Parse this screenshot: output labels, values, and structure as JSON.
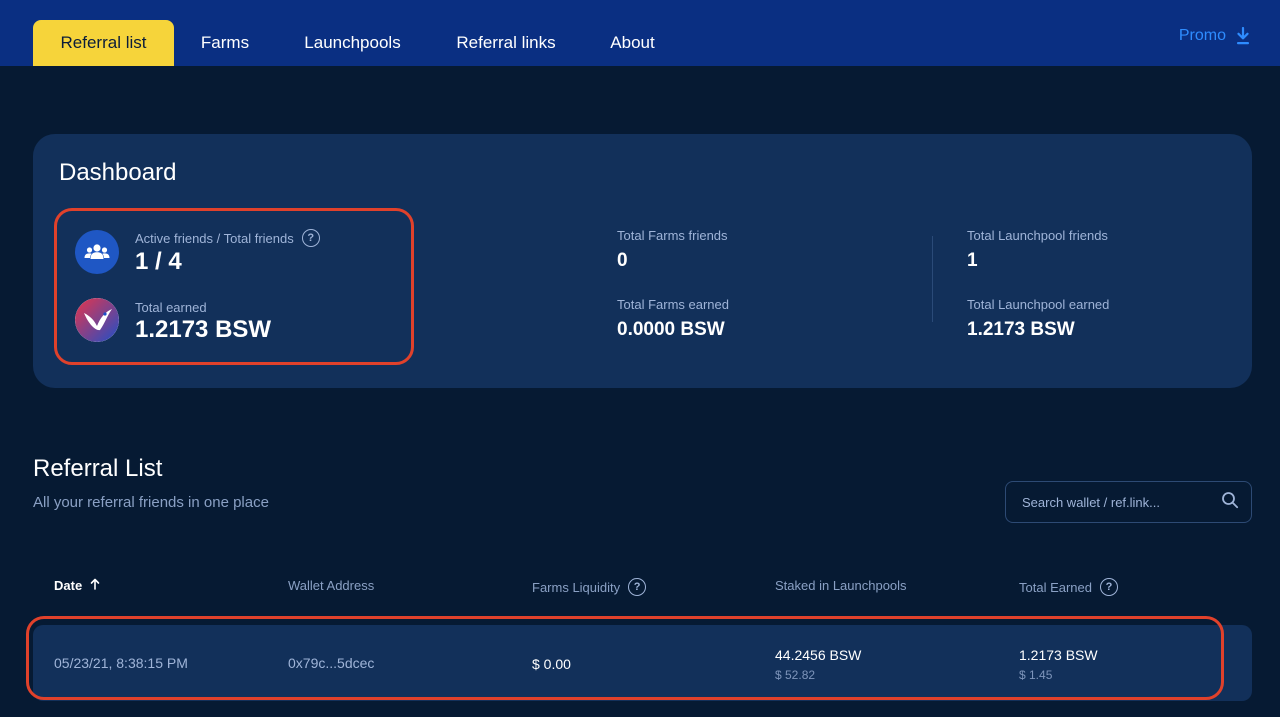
{
  "nav": {
    "tabs": [
      {
        "label": "Referral list",
        "active": true
      },
      {
        "label": "Farms"
      },
      {
        "label": "Launchpools"
      },
      {
        "label": "Referral links"
      },
      {
        "label": "About"
      }
    ],
    "promo_label": "Promo"
  },
  "dashboard": {
    "title": "Dashboard",
    "friends_label": "Active friends / Total friends",
    "friends_value": "1 / 4",
    "earned_label": "Total earned",
    "earned_value": "1.2173 BSW",
    "farms_friends_label": "Total Farms friends",
    "farms_friends_value": "0",
    "farms_earned_label": "Total Farms earned",
    "farms_earned_value": "0.0000 BSW",
    "launch_friends_label": "Total Launchpool friends",
    "launch_friends_value": "1",
    "launch_earned_label": "Total Launchpool earned",
    "launch_earned_value": "1.2173 BSW"
  },
  "referral": {
    "title": "Referral List",
    "subtitle": "All your referral friends in one place",
    "search_placeholder": "Search wallet / ref.link...",
    "columns": {
      "date": "Date",
      "wallet": "Wallet Address",
      "farms": "Farms Liquidity",
      "staked": "Staked in Launchpools",
      "earned": "Total Earned"
    },
    "rows": [
      {
        "date": "05/23/21, 8:38:15 PM",
        "wallet": "0x79c...5dcec",
        "farms": "$ 0.00",
        "staked": "44.2456 BSW",
        "staked_usd": "$ 52.82",
        "earned": "1.2173 BSW",
        "earned_usd": "$ 1.45"
      }
    ]
  },
  "colors": {
    "nav_bg": "#0a2f82",
    "active_tab": "#f6d43a",
    "accent": "#2e8cff",
    "highlight": "#e0412b"
  }
}
